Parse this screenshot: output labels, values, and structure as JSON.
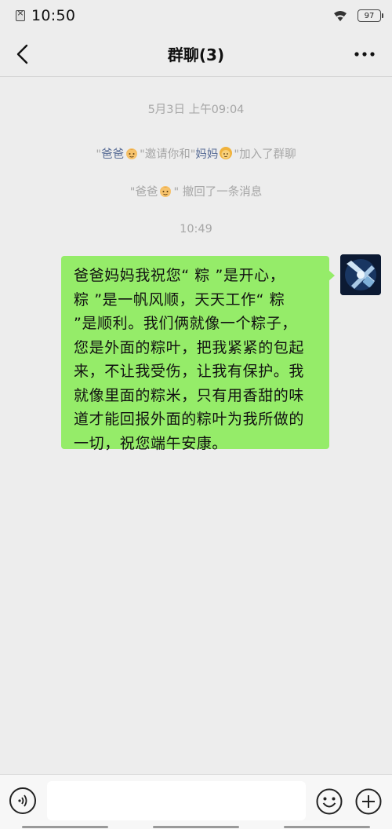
{
  "status_bar": {
    "time": "10:50",
    "battery": "97"
  },
  "header": {
    "title": "群聊(3)"
  },
  "messages": {
    "timestamp_1": "5月3日 上午09:04",
    "invite": {
      "quote_open": "\"",
      "inviter": "爸爸",
      "mid": "\"邀请你和\"",
      "invitee": "妈妈",
      "end": "\"加入了群聊"
    },
    "recall": {
      "quote_open": "\"",
      "name": "爸爸",
      "end": "\" 撤回了一条消息"
    },
    "timestamp_2": "10:49",
    "bubble": {
      "lines": [
        "爸爸妈妈我祝您“ 粽 ”是开心，",
        "粽 ”是一帆风顺，天天工作“ 粽",
        "”是顺利。我们俩就像一个粽子，",
        "您是外面的粽叶，把我紧紧的包起",
        "来，不让我受伤，让我有保护。我",
        "就像里面的粽米，只有用香甜的味",
        "道才能回报外面的粽叶为我所做的",
        "一切，祝您端午安康。"
      ]
    }
  },
  "input": {
    "value": "",
    "placeholder": ""
  },
  "icons": {
    "back": "back-arrow-icon",
    "more": "more-dots-icon",
    "voice": "voice-icon",
    "emoji": "emoji-icon",
    "plus": "plus-icon",
    "wifi": "wifi-icon",
    "battery": "battery-icon",
    "sim": "no-sim-icon"
  },
  "colors": {
    "bubble": "#95ec69",
    "nickname": "#576b95",
    "system_text": "#a6a6a6",
    "background": "#ededed"
  }
}
